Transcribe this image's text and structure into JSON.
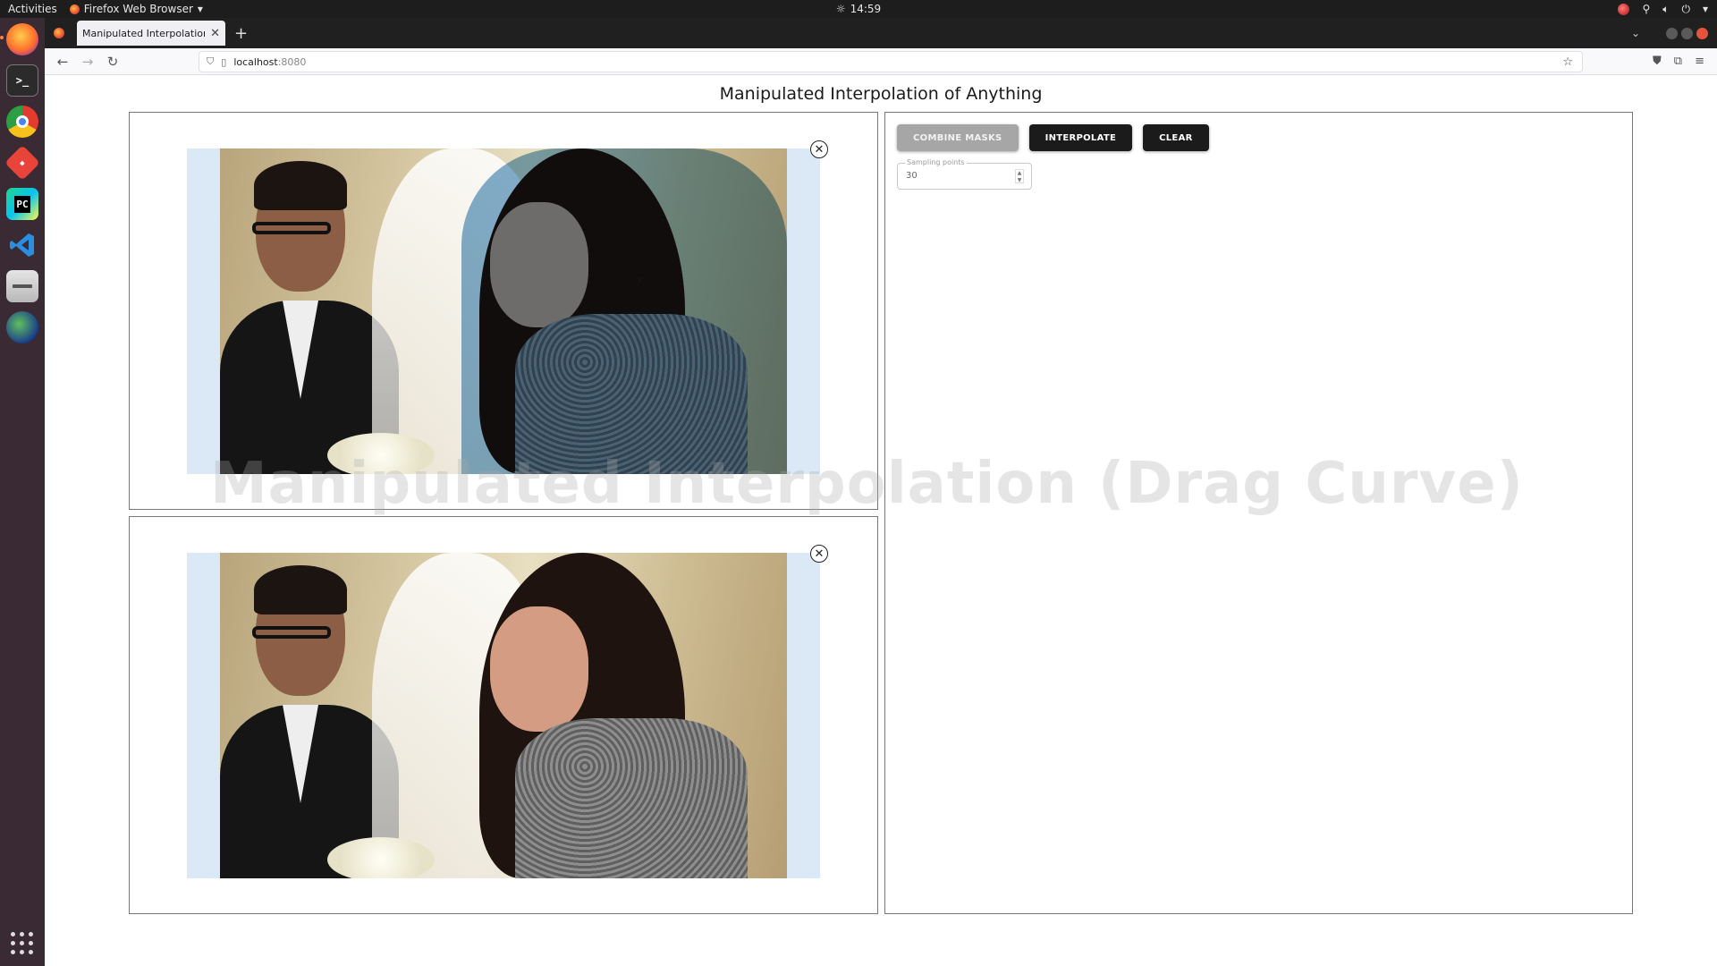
{
  "system": {
    "activities": "Activities",
    "app_menu": "Firefox Web Browser",
    "clock": "14:59"
  },
  "browser": {
    "tab_title": "Manipulated Interpolation o",
    "url_host": "localhost",
    "url_port": ":8080"
  },
  "page": {
    "title": "Manipulated Interpolation of Anything",
    "watermark": "Manipulated Interpolation (Drag Curve)"
  },
  "controls": {
    "combine_masks": "COMBINE MASKS",
    "interpolate": "INTERPOLATE",
    "clear": "CLEAR",
    "sampling_label": "Sampling points",
    "sampling_value": "30"
  },
  "icons": {
    "close": "close-circle-icon",
    "back": "back-arrow-icon",
    "forward": "forward-arrow-icon",
    "reload": "reload-icon",
    "bookmark": "star-icon"
  },
  "colors": {
    "accent_button": "#1b1b1b",
    "disabled_button": "#a6a6a6",
    "image_pad": "#dbe9f6"
  }
}
